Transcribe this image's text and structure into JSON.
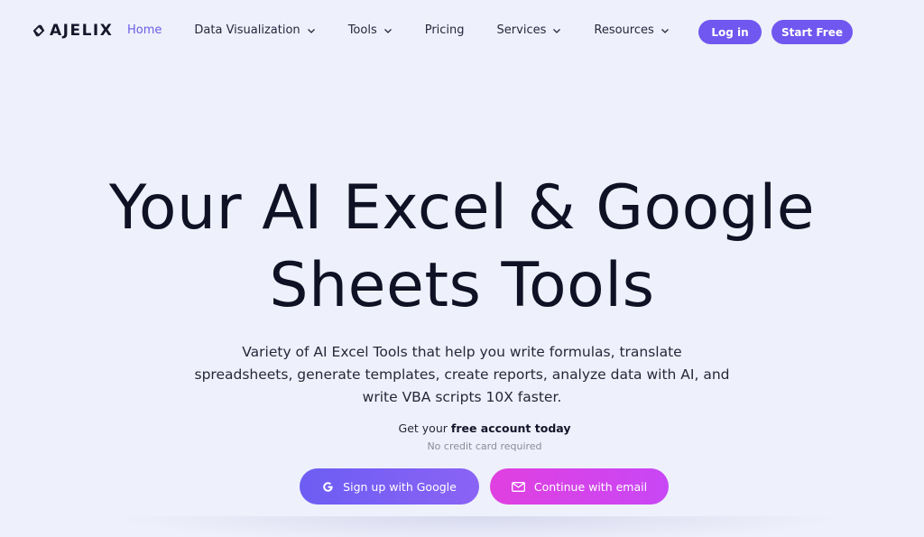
{
  "brand": {
    "name": "AJELIX",
    "logo_icon": "ajelix-logo-icon"
  },
  "nav": {
    "items": [
      {
        "label": "Home",
        "active": true,
        "has_dropdown": false
      },
      {
        "label": "Data Visualization",
        "active": false,
        "has_dropdown": true
      },
      {
        "label": "Tools",
        "active": false,
        "has_dropdown": true
      },
      {
        "label": "Pricing",
        "active": false,
        "has_dropdown": false
      },
      {
        "label": "Services",
        "active": false,
        "has_dropdown": true
      },
      {
        "label": "Resources",
        "active": false,
        "has_dropdown": true
      }
    ],
    "language_icon": "us-flag-icon",
    "login_label": "Log in",
    "start_label": "Start Free"
  },
  "hero": {
    "title_line1": "Your AI Excel & Google",
    "title_line2": "Sheets Tools",
    "subtitle": "Variety of AI Excel Tools that help you write formulas, translate spreadsheets, generate templates, create reports, analyze data with AI, and write VBA scripts 10X faster.",
    "cta_prefix": "Get your ",
    "cta_bold": "free account today",
    "cta_note": "No credit card required",
    "google_button": "Sign up with Google",
    "email_button": "Continue with email"
  },
  "colors": {
    "accent": "#7057f0",
    "active_nav": "#6c5ce7",
    "email_button": "#d944ec",
    "background": "#eef0fb"
  }
}
